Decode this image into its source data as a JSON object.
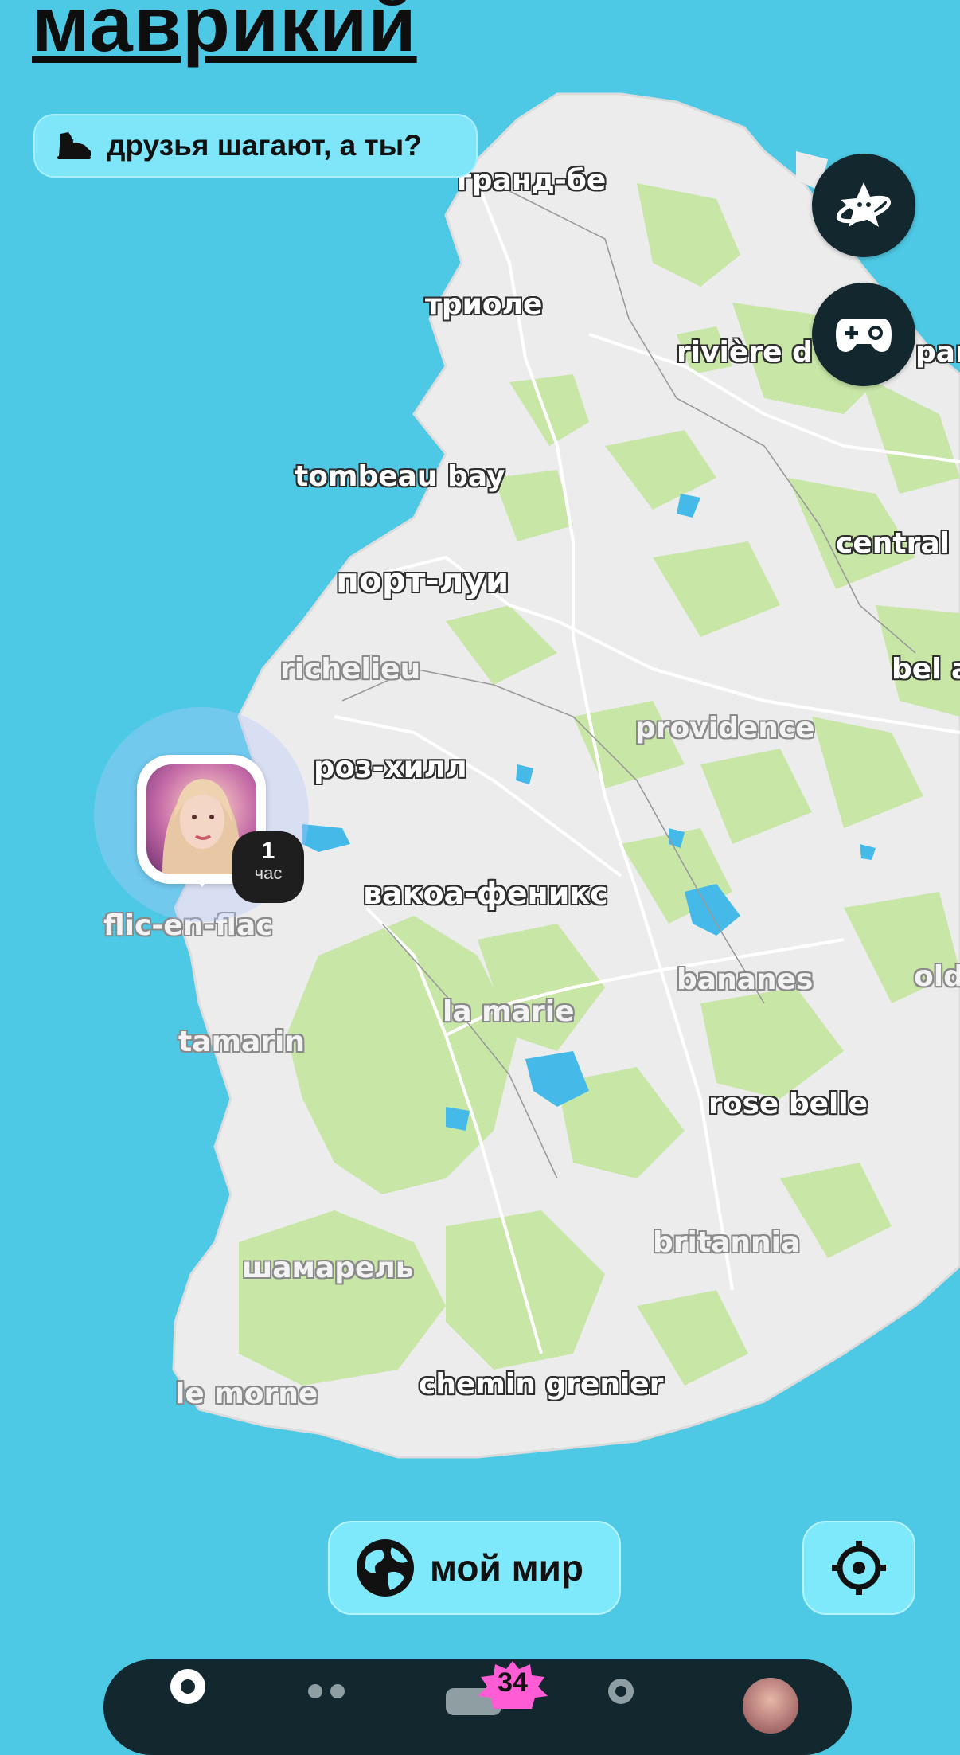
{
  "header": {
    "title": "маврикий",
    "steps_pill": {
      "icon": "sneaker-icon",
      "label": "друзья шагают, а ты?"
    }
  },
  "side_buttons": [
    {
      "name": "planet-star-button",
      "icon": "planet-star-icon"
    },
    {
      "name": "games-button",
      "icon": "gamepad-icon"
    }
  ],
  "map": {
    "place_labels": [
      "гранд-бе",
      "триоле",
      "rivière d",
      "par",
      "tombeau bay",
      "central",
      "порт-луи",
      "richelieu",
      "bel a",
      "providence",
      "роз-хилл",
      "вакоа-феникс",
      "flic-en-flac",
      "bananes",
      "old",
      "la marie",
      "tamarin",
      "rose belle",
      "britannia",
      "шамарель",
      "le morne",
      "chemin grenier"
    ],
    "colors": {
      "sea": "#4ec9e5",
      "land": "#ededed",
      "vegetation": "#c7e5a7",
      "water": "#44b9e6"
    }
  },
  "friend_marker": {
    "time_value": "1",
    "time_unit": "час"
  },
  "bottom": {
    "world_button": {
      "icon": "globe-icon",
      "label": "мой мир"
    },
    "locate_button": {
      "icon": "crosshair-icon"
    }
  },
  "tab_bar": {
    "items": [
      {
        "name": "tab-map",
        "icon": "map-pin-icon"
      },
      {
        "name": "tab-friends",
        "icon": "friends-icon"
      },
      {
        "name": "tab-chat",
        "icon": "chat-icon"
      },
      {
        "name": "tab-people",
        "icon": "person-icon"
      },
      {
        "name": "tab-profile",
        "icon": "avatar-icon"
      }
    ],
    "notification_count": "34"
  }
}
